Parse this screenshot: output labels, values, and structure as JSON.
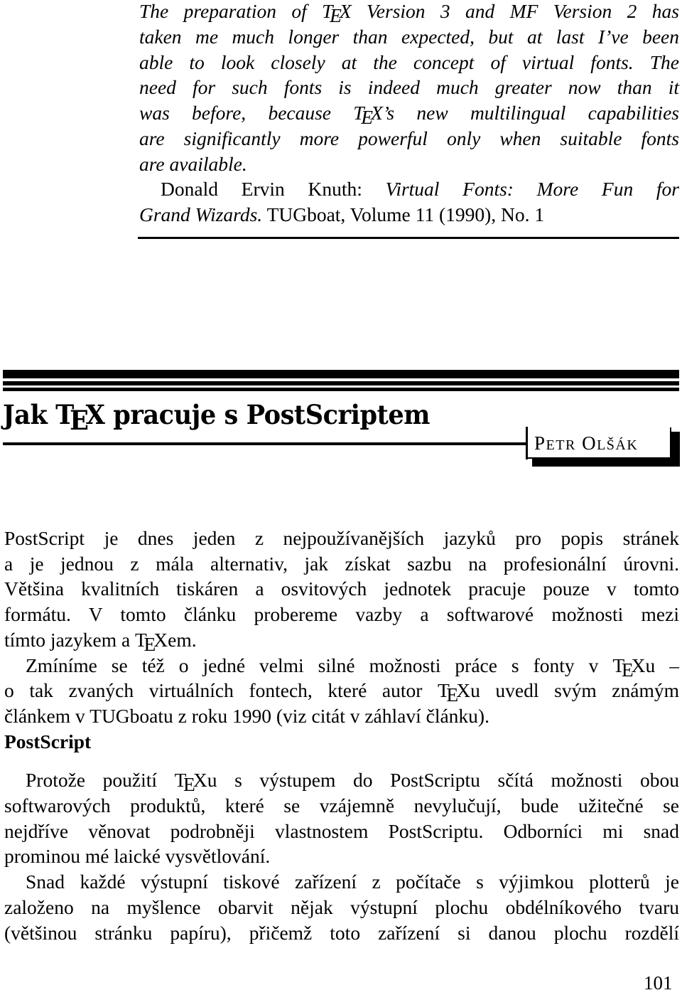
{
  "epigraph": {
    "lines": [
      [
        "The preparation of ",
        "TEX",
        " Version 3 and MF Version 2 has"
      ],
      [
        "taken me much longer than expected, but at last I’ve been"
      ],
      [
        "able to look closely at the concept of virtual fonts.  The"
      ],
      [
        "need for such fonts is indeed much greater now than it"
      ],
      [
        "was before, because ",
        "TEX",
        "’s new multilingual capabilities"
      ],
      [
        "are significantly more powerful only when suitable fonts"
      ],
      [
        "are available."
      ]
    ],
    "attribution": {
      "author": "Donald Ervin Knuth:",
      "work_title_part1": "Virtual Fonts: More Fun for",
      "work_title_part2": "Grand Wizards.",
      "source": " TUGboat, Volume 11 (1990), No. 1"
    }
  },
  "article": {
    "title_before": "Jak ",
    "title_logo": "TEX",
    "title_after": " pracuje s PostScriptem",
    "author_first_initial": "P",
    "author_first_rest": "ETR",
    "author_last_initial": "O",
    "author_last_rest": "LŠÁK"
  },
  "logo": {
    "t": "T",
    "e": "E",
    "x": "X"
  },
  "body": {
    "para1": [
      [
        "PostScript je dnes jeden z nejpoužívanějších jazyků pro popis stránek"
      ],
      [
        "a je jednou z mála alternativ, jak získat sazbu na profesionální úrovni."
      ],
      [
        "Většina kvalitních tiskáren a osvitových jednotek pracuje pouze v tomto"
      ],
      [
        "formátu. V tomto článku probereme vazby a softwarové možnosti mezi"
      ],
      [
        "tímto jazykem a ",
        "TEX",
        "em."
      ]
    ],
    "para2": [
      [
        "Zmíníme se též o jedné velmi silné možnosti práce s fonty v ",
        "TEX",
        "u –"
      ],
      [
        "o tak zvaných virtuálních fontech, které autor ",
        "TEX",
        "u uvedl svým známým"
      ],
      [
        "článkem v TUGboatu z roku 1990 (viz citát v záhlaví článku)."
      ]
    ],
    "section_heading": "PostScript",
    "para3": [
      [
        "Protože použití ",
        "TEX",
        "u s výstupem do PostScriptu sčítá možnosti obou"
      ],
      [
        "softwarových produktů, které se vzájemně nevylučují, bude užitečné se"
      ],
      [
        "nejdříve věnovat podrobněji vlastnostem PostScriptu. Odborníci mi snad"
      ],
      [
        "prominou mé laické vysvětlování."
      ]
    ],
    "para4": [
      [
        "Snad každé výstupní tiskové zařízení z počítače s výjimkou plotterů je"
      ],
      [
        "založeno na myšlence obarvit nějak výstupní plochu obdélníkového tvaru"
      ],
      [
        "(většinou stránku papíru), přičemž toto zařízení si danou plochu rozdělí"
      ]
    ]
  },
  "page_number": "101"
}
